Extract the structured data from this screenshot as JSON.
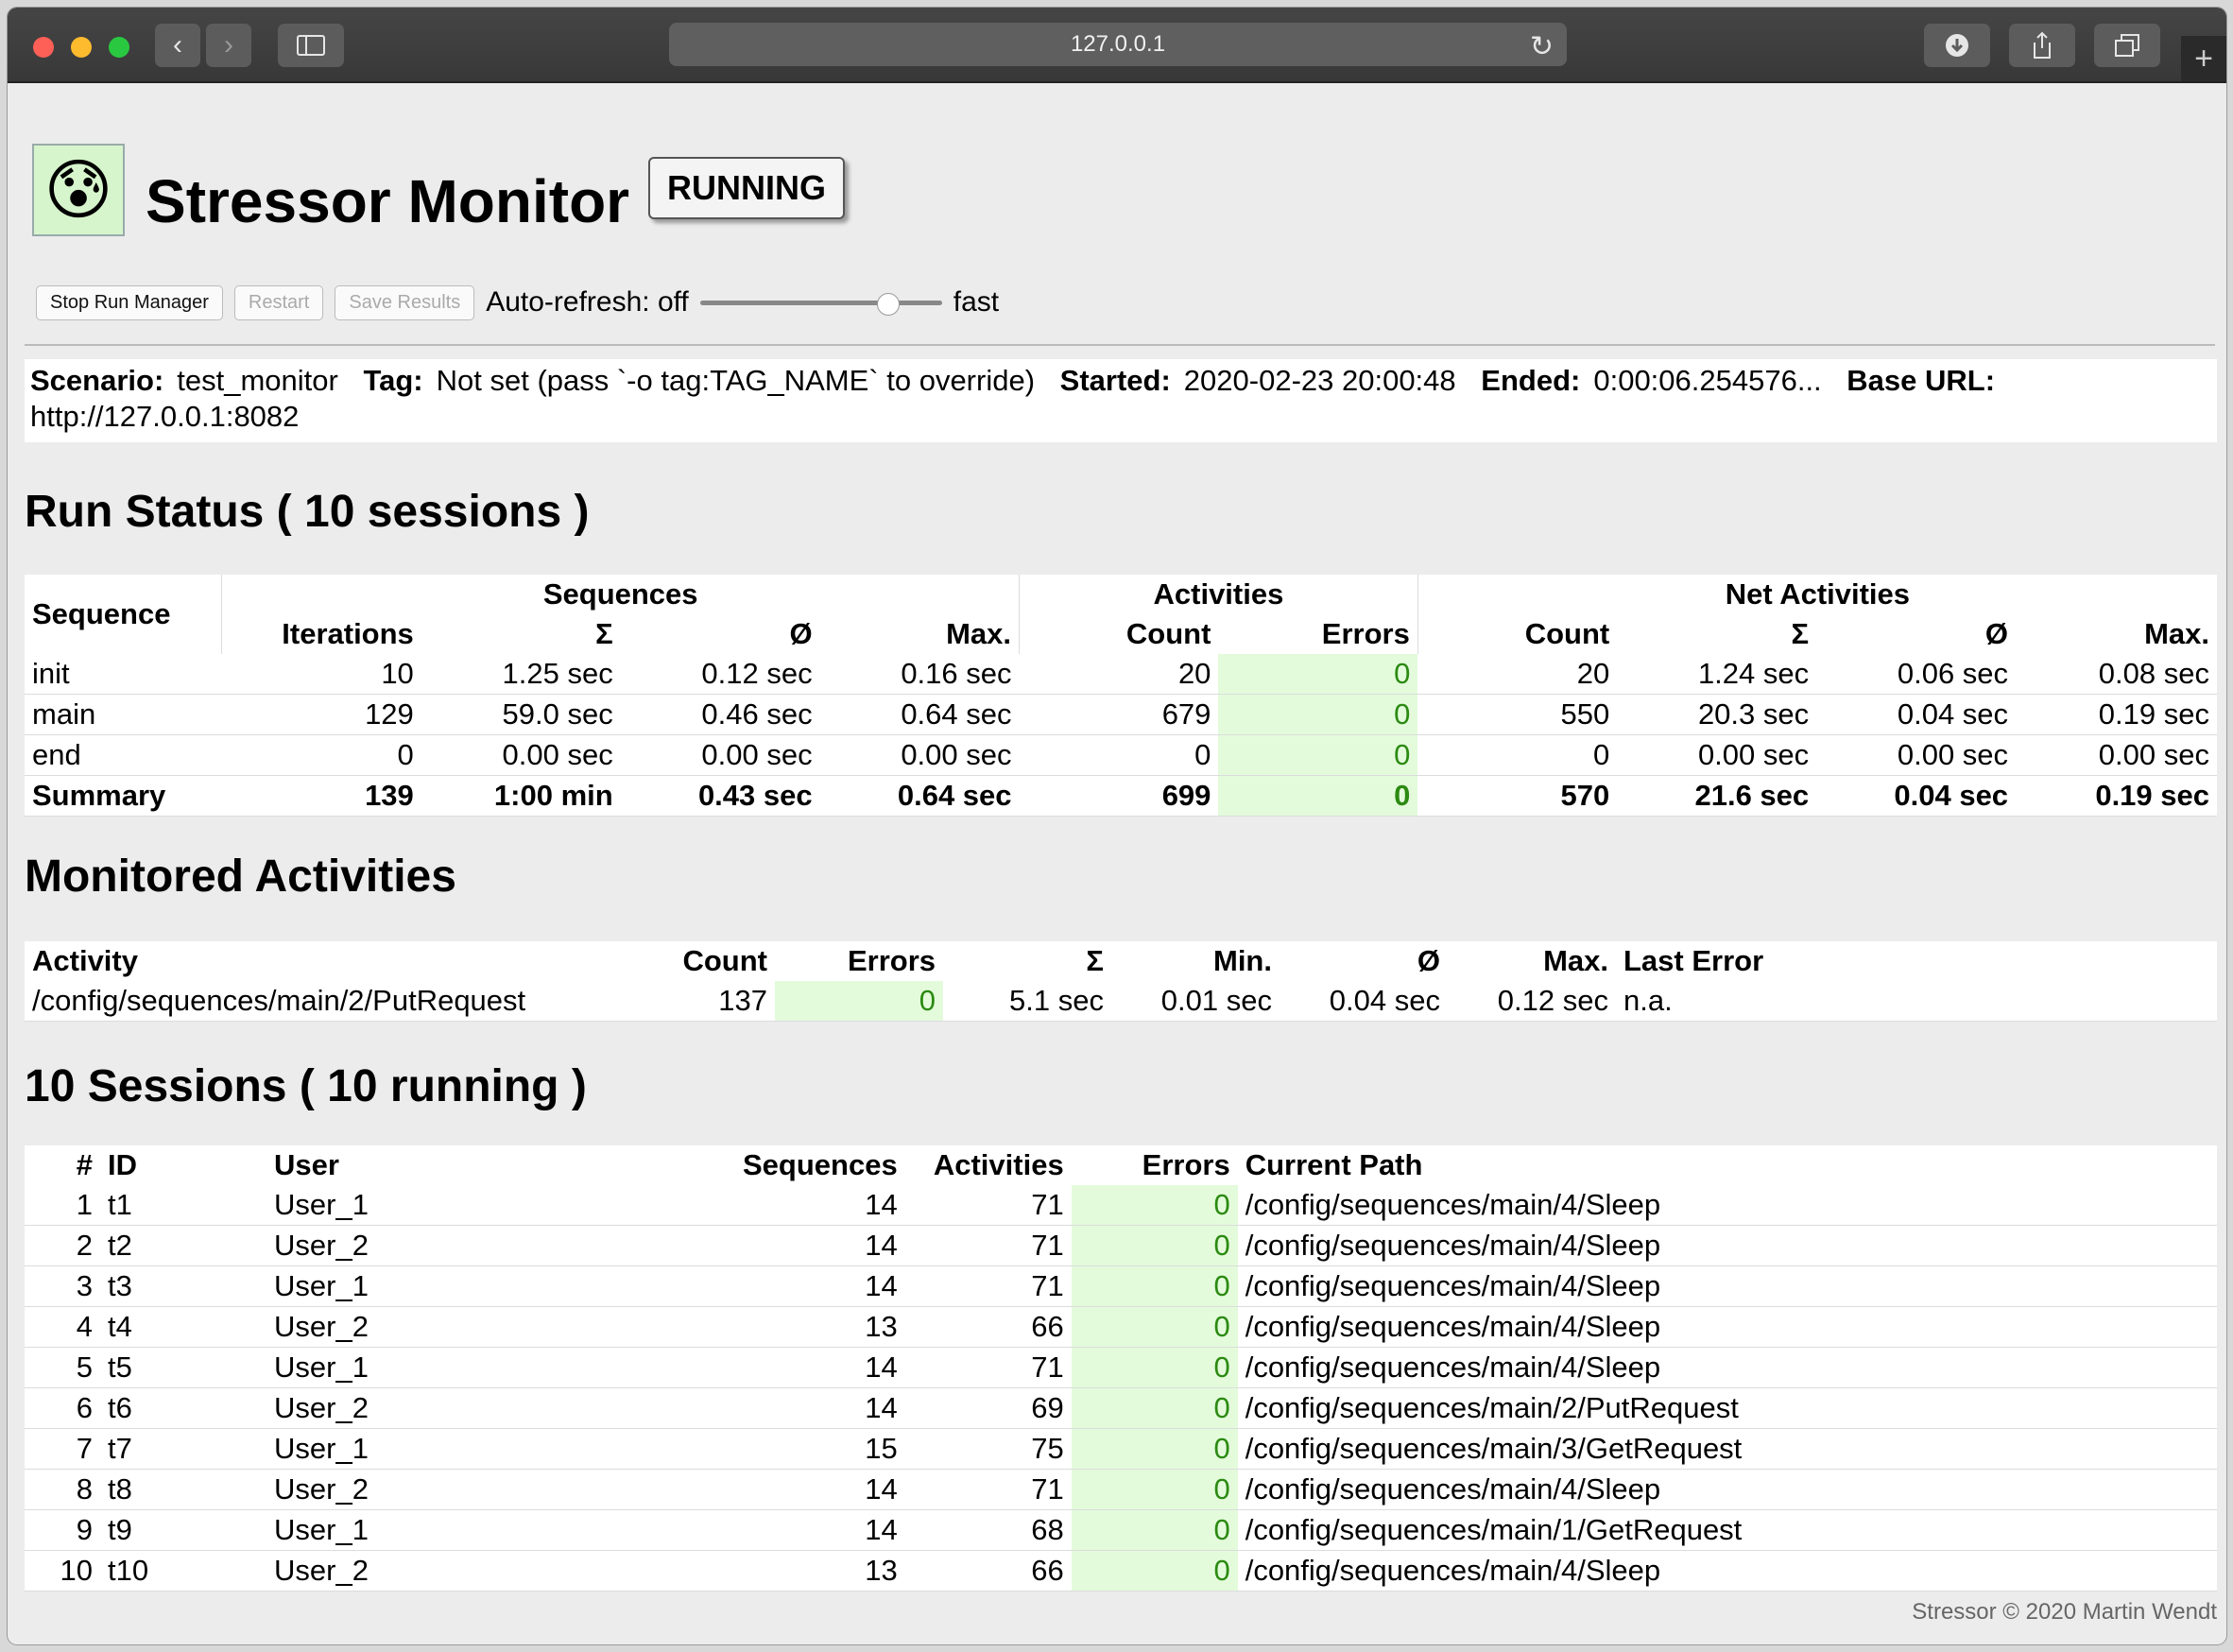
{
  "browser": {
    "address": "127.0.0.1",
    "back_icon": "chevron-left-icon",
    "forward_icon": "chevron-right-icon"
  },
  "header": {
    "logo_icon": "anxious-face-icon",
    "title": "Stressor Monitor",
    "status": "RUNNING"
  },
  "controls": {
    "stop_label": "Stop Run Manager",
    "restart_label": "Restart",
    "save_label": "Save Results",
    "autorefresh_label": "Auto-refresh: off",
    "slider_fast": "fast",
    "slider_value": 0.8
  },
  "meta": {
    "scenario_label": "Scenario:",
    "scenario": "test_monitor",
    "tag_label": "Tag:",
    "tag": "Not set (pass `-o tag:TAG_NAME` to override)",
    "started_label": "Started:",
    "started": "2020-02-23 20:00:48",
    "ended_label": "Ended:",
    "ended": "0:00:06.254576...",
    "baseurl_label": "Base URL:",
    "baseurl": "http://127.0.0.1:8082"
  },
  "run_status": {
    "heading": "Run Status ( 10 sessions )",
    "group_headers": [
      "Sequences",
      "Activities",
      "Net Activities"
    ],
    "col_sequence": "Sequence",
    "columns": [
      "Iterations",
      "Σ",
      "Ø",
      "Max.",
      "Count",
      "Errors",
      "Count",
      "Σ",
      "Ø",
      "Max."
    ],
    "rows": [
      [
        "init",
        "10",
        "1.25 sec",
        "0.12 sec",
        "0.16 sec",
        "20",
        "0",
        "20",
        "1.24 sec",
        "0.06 sec",
        "0.08 sec"
      ],
      [
        "main",
        "129",
        "59.0 sec",
        "0.46 sec",
        "0.64 sec",
        "679",
        "0",
        "550",
        "20.3 sec",
        "0.04 sec",
        "0.19 sec"
      ],
      [
        "end",
        "0",
        "0.00 sec",
        "0.00 sec",
        "0.00 sec",
        "0",
        "0",
        "0",
        "0.00 sec",
        "0.00 sec",
        "0.00 sec"
      ]
    ],
    "summary": [
      "Summary",
      "139",
      "1:00 min",
      "0.43 sec",
      "0.64 sec",
      "699",
      "0",
      "570",
      "21.6 sec",
      "0.04 sec",
      "0.19 sec"
    ]
  },
  "monitored": {
    "heading": "Monitored Activities",
    "columns": [
      "Activity",
      "Count",
      "Errors",
      "Σ",
      "Min.",
      "Ø",
      "Max.",
      "Last Error"
    ],
    "rows": [
      [
        "/config/sequences/main/2/PutRequest",
        "137",
        "0",
        "5.1 sec",
        "0.01 sec",
        "0.04 sec",
        "0.12 sec",
        "n.a."
      ]
    ]
  },
  "sessions": {
    "heading": "10 Sessions ( 10 running )",
    "columns": [
      "#",
      "ID",
      "User",
      "Sequences",
      "Activities",
      "Errors",
      "Current Path"
    ],
    "rows": [
      [
        "1",
        "t1",
        "User_1",
        "14",
        "71",
        "0",
        "/config/sequences/main/4/Sleep"
      ],
      [
        "2",
        "t2",
        "User_2",
        "14",
        "71",
        "0",
        "/config/sequences/main/4/Sleep"
      ],
      [
        "3",
        "t3",
        "User_1",
        "14",
        "71",
        "0",
        "/config/sequences/main/4/Sleep"
      ],
      [
        "4",
        "t4",
        "User_2",
        "13",
        "66",
        "0",
        "/config/sequences/main/4/Sleep"
      ],
      [
        "5",
        "t5",
        "User_1",
        "14",
        "71",
        "0",
        "/config/sequences/main/4/Sleep"
      ],
      [
        "6",
        "t6",
        "User_2",
        "14",
        "69",
        "0",
        "/config/sequences/main/2/PutRequest"
      ],
      [
        "7",
        "t7",
        "User_1",
        "15",
        "75",
        "0",
        "/config/sequences/main/3/GetRequest"
      ],
      [
        "8",
        "t8",
        "User_2",
        "14",
        "71",
        "0",
        "/config/sequences/main/4/Sleep"
      ],
      [
        "9",
        "t9",
        "User_1",
        "14",
        "68",
        "0",
        "/config/sequences/main/1/GetRequest"
      ],
      [
        "10",
        "t10",
        "User_2",
        "13",
        "66",
        "0",
        "/config/sequences/main/4/Sleep"
      ]
    ]
  },
  "footer": "Stressor © 2020 Martin Wendt",
  "colors": {
    "error_bg": "#e3fbdb",
    "error_fg": "#2b8a11"
  }
}
